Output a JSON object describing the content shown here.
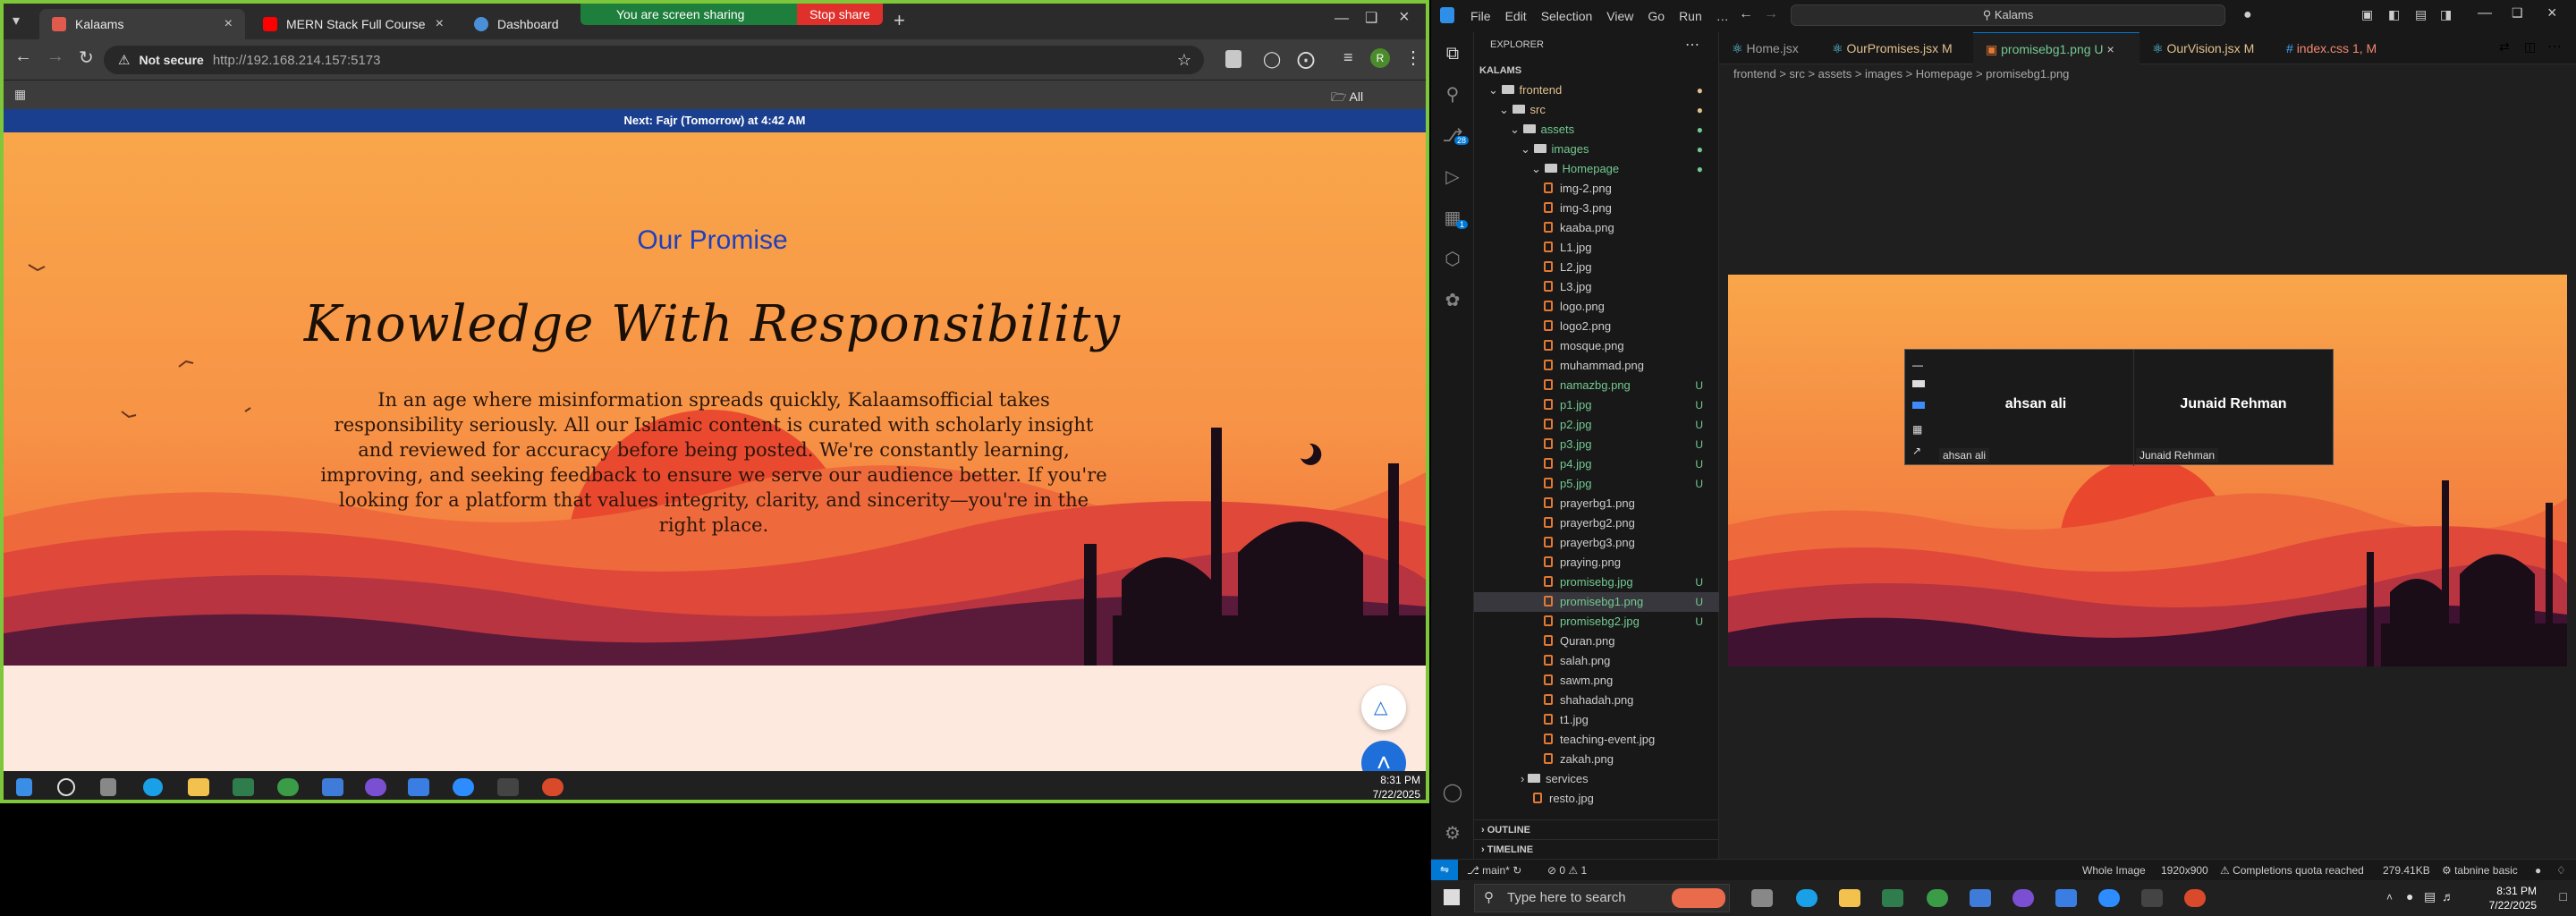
{
  "browser": {
    "tabs": [
      {
        "label": "Kalaams",
        "color": "#e05a4e"
      },
      {
        "label": "MERN Stack Full Course - ECom",
        "color": "#ff0000"
      },
      {
        "label": "Dashboard",
        "color": "#4a90d9"
      }
    ],
    "share_banner": {
      "message": "You are screen sharing",
      "stop_label": "Stop share"
    },
    "security": "Not secure",
    "url": "http://192.168.214.157:5173",
    "bookmarks_label": "All Bookmarks",
    "profile_initial": "R"
  },
  "page": {
    "next_prayer": {
      "prefix": "Next:",
      "prayer": "Fajr (Tomorrow)",
      "suffix": "at 4:42 AM"
    },
    "section_label": "Our Promise",
    "title": "Knowledge With Responsibility",
    "body": "In an age where misinformation spreads quickly, Kalaamsofficial takes responsibility seriously. All our Islamic content is curated with scholarly insight and reviewed for accuracy before being posted. We're constantly learning, improving, and seeking feedback to ensure we serve our audience better. If you're looking for a platform that values integrity, clarity, and sincerity—you're in the right place.",
    "colors": {
      "accent": "#1f3fbf",
      "nav": "#1b3f8f",
      "sky_top": "#f9a64a",
      "sun": "#e8412c"
    }
  },
  "left_taskbar": {
    "time": "8:31 PM",
    "date": "7/22/2025"
  },
  "vscode": {
    "menu": [
      "File",
      "Edit",
      "Selection",
      "View",
      "Go",
      "Run",
      "…"
    ],
    "search": "Kalams",
    "explorer_title": "EXPLORER",
    "root": "KALAMS",
    "folders": [
      "frontend",
      "src",
      "assets",
      "images",
      "Homepage"
    ],
    "files": [
      {
        "name": "img-2.png",
        "status": ""
      },
      {
        "name": "img-3.png",
        "status": ""
      },
      {
        "name": "kaaba.png",
        "status": ""
      },
      {
        "name": "L1.jpg",
        "status": ""
      },
      {
        "name": "L2.jpg",
        "status": ""
      },
      {
        "name": "L3.jpg",
        "status": ""
      },
      {
        "name": "logo.png",
        "status": ""
      },
      {
        "name": "logo2.png",
        "status": ""
      },
      {
        "name": "mosque.png",
        "status": ""
      },
      {
        "name": "muhammad.png",
        "status": ""
      },
      {
        "name": "namazbg.png",
        "status": "U"
      },
      {
        "name": "p1.jpg",
        "status": "U"
      },
      {
        "name": "p2.jpg",
        "status": "U"
      },
      {
        "name": "p3.jpg",
        "status": "U"
      },
      {
        "name": "p4.jpg",
        "status": "U"
      },
      {
        "name": "p5.jpg",
        "status": "U"
      },
      {
        "name": "prayerbg1.png",
        "status": ""
      },
      {
        "name": "prayerbg2.png",
        "status": ""
      },
      {
        "name": "prayerbg3.png",
        "status": ""
      },
      {
        "name": "praying.png",
        "status": ""
      },
      {
        "name": "promisebg.jpg",
        "status": "U"
      },
      {
        "name": "promisebg1.png",
        "status": "U"
      },
      {
        "name": "promisebg2.jpg",
        "status": "U"
      },
      {
        "name": "Quran.png",
        "status": ""
      },
      {
        "name": "salah.png",
        "status": ""
      },
      {
        "name": "sawm.png",
        "status": ""
      },
      {
        "name": "shahadah.png",
        "status": ""
      },
      {
        "name": "t1.jpg",
        "status": ""
      },
      {
        "name": "teaching-event.jpg",
        "status": ""
      },
      {
        "name": "zakah.png",
        "status": ""
      }
    ],
    "selected_file": "promisebg1.png",
    "after_folder": "services",
    "after_file": "resto.jpg",
    "outline": "OUTLINE",
    "timeline": "TIMELINE",
    "tabs": [
      {
        "label": "Home.jsx",
        "mark": ""
      },
      {
        "label": "OurPromises.jsx",
        "mark": "M"
      },
      {
        "label": "promisebg1.png",
        "mark": "U"
      },
      {
        "label": "OurVision.jsx",
        "mark": "M"
      },
      {
        "label": "index.css",
        "mark": "1, M"
      }
    ],
    "breadcrumb": "frontend > src > assets > images > Homepage > promisebg1.png",
    "scm_badge": "28",
    "ext_badge": "1",
    "status": {
      "branch": "main*",
      "problems": "⊘ 0 ⚠ 1",
      "image_mode": "Whole Image",
      "dimensions": "1920x900",
      "quota": "Completions quota reached",
      "size": "279.41KB",
      "tabnine": "tabnine basic"
    }
  },
  "zoom_popup": {
    "participants": [
      "ahsan ali",
      "Junaid Rehman"
    ]
  },
  "right_taskbar": {
    "search_placeholder": "Type here to search",
    "time": "8:31 PM",
    "date": "7/22/2025"
  }
}
